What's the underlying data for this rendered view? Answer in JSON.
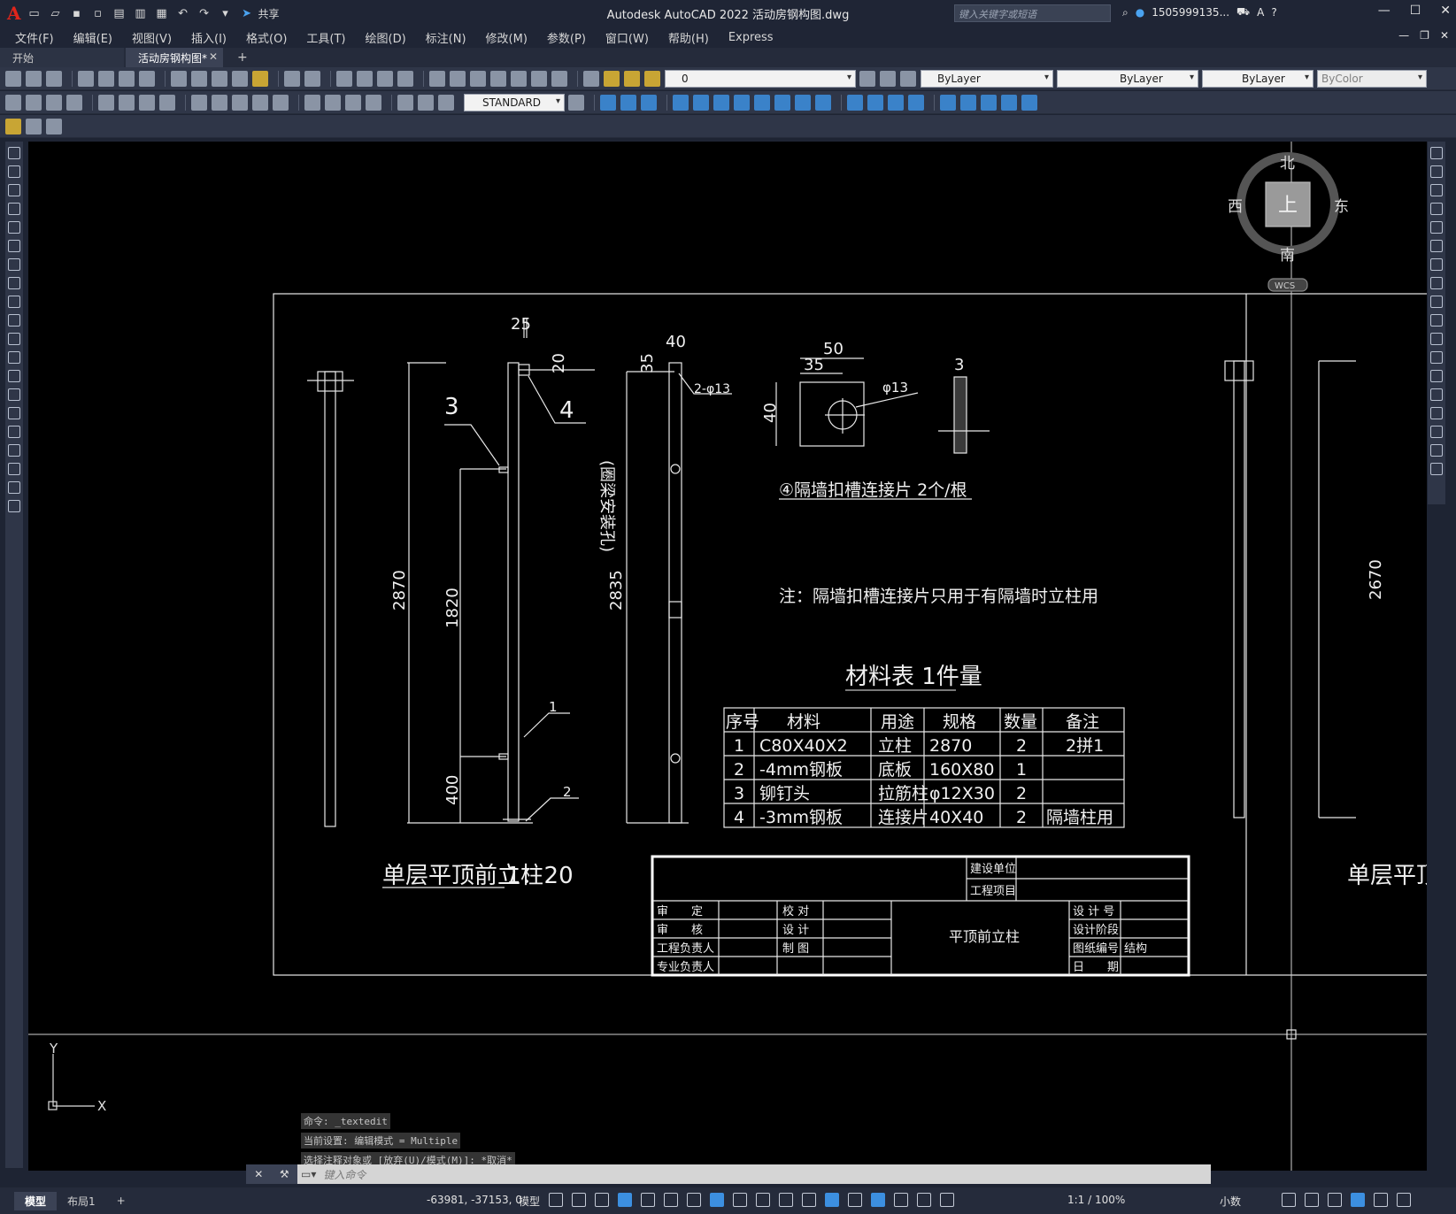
{
  "app": {
    "logo": "A",
    "title": "Autodesk AutoCAD 2022    活动房钢构图.dwg",
    "share": "共享",
    "search_placeholder": "键入关键字或短语",
    "user": "1505999135...",
    "window_controls": [
      "—",
      "☐",
      "✕"
    ]
  },
  "menu": [
    "文件(F)",
    "编辑(E)",
    "视图(V)",
    "插入(I)",
    "格式(O)",
    "工具(T)",
    "绘图(D)",
    "标注(N)",
    "修改(M)",
    "参数(P)",
    "窗口(W)",
    "帮助(H)",
    "Express"
  ],
  "tabs": {
    "start": "开始",
    "active": "活动房钢构图*",
    "close": "✕",
    "plus": "+"
  },
  "toolbar": {
    "layer": "0",
    "color": "ByLayer",
    "linetype": "ByLayer",
    "lineweight": "ByLayer",
    "plotstyle": "ByColor",
    "textstyle": "STANDARD"
  },
  "viewcube": {
    "north": "北",
    "south": "南",
    "east": "东",
    "west": "西",
    "top": "上",
    "wcs": "WCS"
  },
  "drawing": {
    "dims": {
      "d25": "25",
      "d40": "40",
      "d20": "20",
      "d35": "35",
      "hole2": "2-φ13",
      "d2870": "2870",
      "d1820": "1820",
      "d400": "400",
      "d2835": "2835",
      "beam_hole": "(圈梁安装孔)",
      "plate50": "50",
      "plate35": "35",
      "plate40": "40",
      "phi13": "φ13",
      "thick3": "3",
      "d2670": "2670"
    },
    "callouts": {
      "c1": "1",
      "c2": "2",
      "c3": "3",
      "c4": "4"
    },
    "plate_title": "④隔墙扣槽连接片  2个/根",
    "note": "注：隔墙扣槽连接片只用于有隔墙时立柱用",
    "view_title": "单层平顶前立柱",
    "view_scale": "1：20",
    "view_title_right": "单层平顶"
  },
  "material_table": {
    "title": "材料表 1件量",
    "headers": [
      "序号",
      "材料",
      "用途",
      "规格",
      "数量",
      "备注"
    ],
    "rows": [
      [
        "1",
        "C80X40X2",
        "立柱",
        "2870",
        "2",
        "2拼1"
      ],
      [
        "2",
        "-4mm钢板",
        "底板",
        "160X80",
        "1",
        ""
      ],
      [
        "3",
        "铆钉头",
        "拉筋柱",
        "φ12X30",
        "2",
        ""
      ],
      [
        "4",
        "-3mm钢板",
        "连接片",
        "40X40",
        "2",
        "隔墙柱用"
      ]
    ]
  },
  "title_block": {
    "build_unit": "建设单位",
    "project": "工程项目",
    "left_labels": [
      "审　　定",
      "审　　核",
      "工程负责人",
      "专业负责人"
    ],
    "mid_labels": [
      "校 对",
      "设 计",
      "制 图"
    ],
    "drawing_name": "平顶前立柱",
    "right_labels": [
      "设 计 号",
      "设计阶段",
      "图纸编号",
      "日　　期"
    ],
    "discipline": "结构"
  },
  "ucs": {
    "x": "X",
    "y": "Y"
  },
  "command": {
    "history": [
      "命令: _textedit",
      "当前设置: 编辑模式 = Multiple",
      "选择注释对象或 [放弃(U)/模式(M)]: *取消*"
    ],
    "placeholder": "键入命令"
  },
  "status": {
    "model_tab": "模型",
    "layout_tab": "布局1",
    "add": "+",
    "coords": "-63981, -37153, 0",
    "model": "模型",
    "scale": "1:1 / 100%",
    "units": "小数"
  }
}
